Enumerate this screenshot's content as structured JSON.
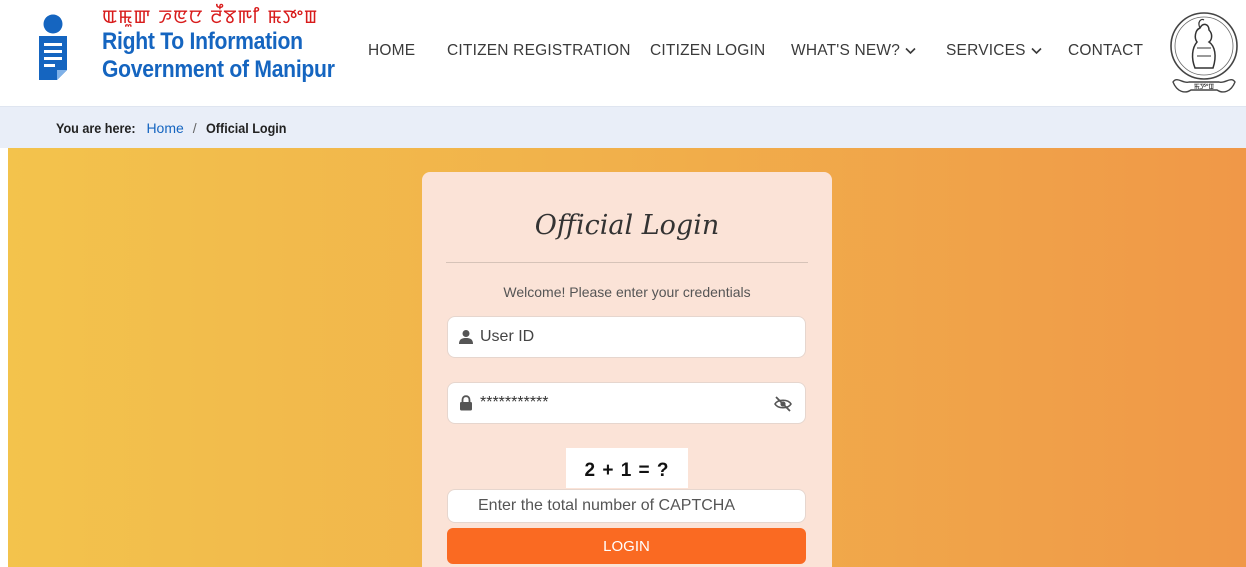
{
  "brand": {
    "script_text": "ꯑꯃꯨꯛ ꯍꯟꯅ ꯂꯩꯕꯒꯤ ꯃꯇꯦꯡ",
    "line1": "Right To Information",
    "line2": "Government of Manipur",
    "color": "#1565c0",
    "script_color": "#d81b1b"
  },
  "nav": {
    "home": "HOME",
    "citizen_registration": "CITIZEN REGISTRATION",
    "citizen_login": "CITIZEN LOGIN",
    "whats_new": "WHAT'S NEW?",
    "services": "SERVICES",
    "contact": "CONTACT"
  },
  "breadcrumb": {
    "prefix": "You are here:",
    "home": "Home",
    "separator": "/",
    "current": "Official Login"
  },
  "login": {
    "title": "Official Login",
    "subtitle": "Welcome! Please enter your credentials",
    "user_placeholder": "User ID",
    "password_value": "***********",
    "captcha_question": "2 + 1 = ?",
    "captcha_placeholder": "Enter the total number of CAPTCHA",
    "button": "LOGIN"
  },
  "icons": {
    "logo": "rti-info-logo-icon",
    "emblem": "manipur-emblem-icon",
    "user": "user-icon",
    "lock": "lock-icon",
    "eye": "eye-slash-icon",
    "chevron": "chevron-down-icon"
  },
  "colors": {
    "accent": "#fa6a22",
    "hero_start": "#f3c34c",
    "hero_end": "#f09848",
    "card": "#fbe3d7",
    "breadcrumb_bg": "#e9eef8"
  }
}
